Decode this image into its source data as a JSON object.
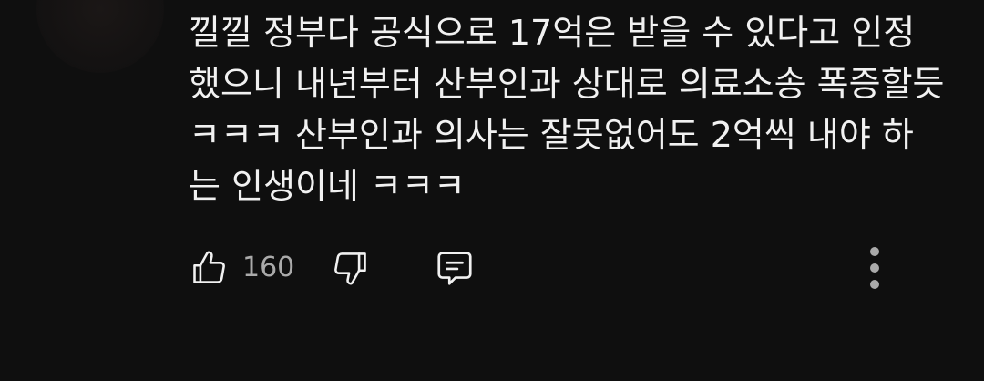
{
  "comment": {
    "text": "낄낄 정부다 공식으로 17억은 받을 수 있다고 인정했으니 내년부터 산부인과 상대로 의료소송 폭증할듯 ㅋㅋㅋ 산부인과 의사는 잘못없어도 2억씩 내야 하는 인생이네 ㅋㅋㅋ"
  },
  "actions": {
    "like_count": "160",
    "icons": [
      "thumbs-up-icon",
      "thumbs-down-icon",
      "reply-icon",
      "more-vertical-icon"
    ]
  },
  "colors": {
    "background": "#0f0f0f",
    "text": "#f1f1f1",
    "secondary": "#aaaaaa"
  }
}
